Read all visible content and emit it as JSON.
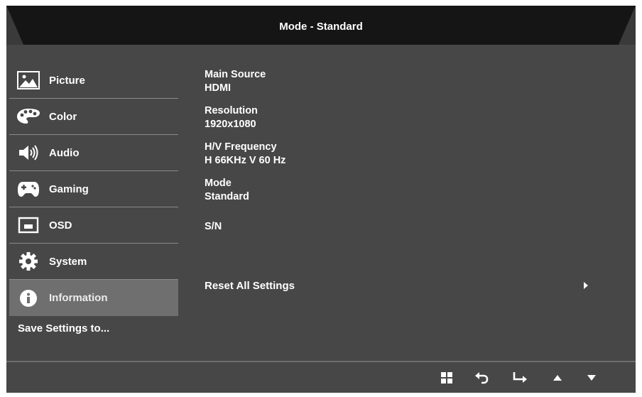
{
  "header": {
    "title": "Mode - Standard"
  },
  "sidebar": {
    "items": [
      {
        "label": "Picture",
        "icon": "picture-icon"
      },
      {
        "label": "Color",
        "icon": "palette-icon"
      },
      {
        "label": "Audio",
        "icon": "speaker-icon"
      },
      {
        "label": "Gaming",
        "icon": "gamepad-icon"
      },
      {
        "label": "OSD",
        "icon": "osd-icon"
      },
      {
        "label": "System",
        "icon": "gear-icon"
      },
      {
        "label": "Information",
        "icon": "info-icon",
        "active": true
      }
    ],
    "save_label": "Save Settings to..."
  },
  "info": {
    "main_source": {
      "label": "Main Source",
      "value": "HDMI"
    },
    "resolution": {
      "label": "Resolution",
      "value": "1920x1080"
    },
    "frequency": {
      "label": "H/V Frequency",
      "value": "H 66KHz V 60 Hz"
    },
    "mode": {
      "label": "Mode",
      "value": "Standard"
    },
    "serial": {
      "label": "S/N"
    },
    "reset_label": "Reset All Settings"
  },
  "footer": {
    "icons": [
      "menu-grid-icon",
      "back-icon",
      "enter-icon",
      "up-arrow-icon",
      "down-arrow-icon"
    ]
  },
  "colors": {
    "panel": "#474747",
    "header": "#151515",
    "active": "#6f6f6f",
    "divider": "#8a8a8a",
    "text": "#ffffff"
  }
}
